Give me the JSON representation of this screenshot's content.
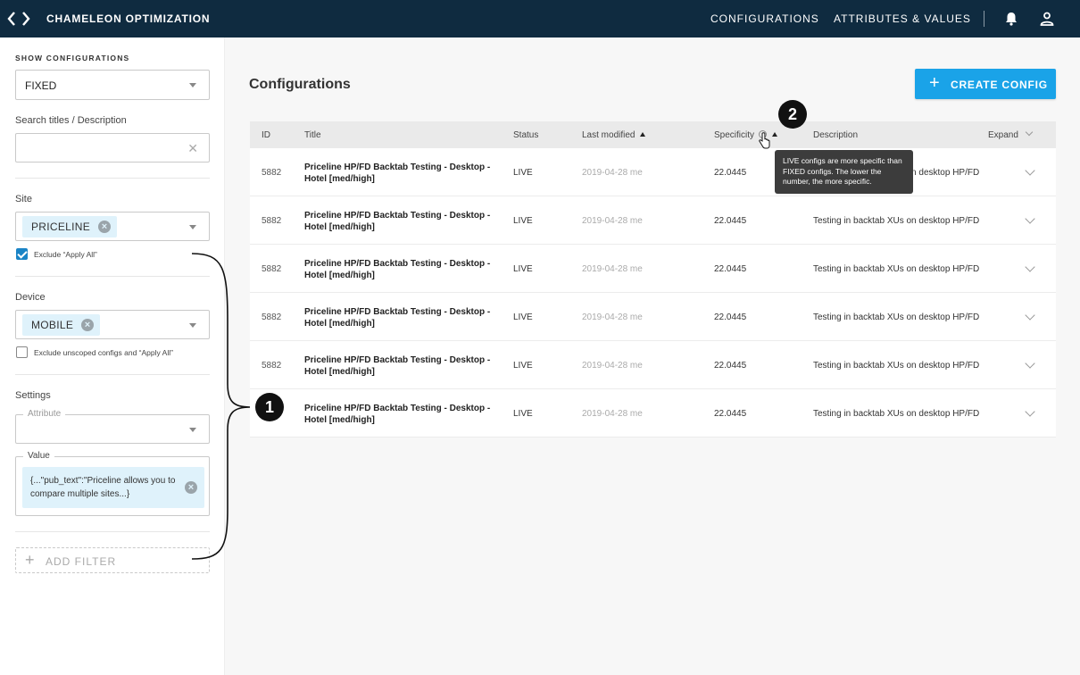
{
  "header": {
    "app_title": "CHAMELEON OPTIMIZATION",
    "nav": [
      "CONFIGURATIONS",
      "ATTRIBUTES & VALUES"
    ],
    "icons": [
      "code-logo-icon",
      "bell-icon",
      "user-icon"
    ]
  },
  "sidebar": {
    "show_label": "SHOW CONFIGURATIONS",
    "show_value": "FIXED",
    "search_label": "Search titles / Description",
    "search_value": "",
    "site_label": "Site",
    "site_chip": "PRICELINE",
    "site_exclude_label": "Exclude “Apply All”",
    "site_exclude_checked": true,
    "device_label": "Device",
    "device_chip": "MOBILE",
    "device_exclude_label": "Exclude unscoped configs and “Apply All”",
    "device_exclude_checked": false,
    "settings_label": "Settings",
    "attribute_label": "Attribute",
    "value_label": "Value",
    "value_text": "{...\"pub_text\":\"Priceline allows you to compare multiple sites...}",
    "add_filter_label": "ADD FILTER"
  },
  "main": {
    "title": "Configurations",
    "create_label": "CREATE CONFIG",
    "columns": [
      "ID",
      "Title",
      "Status",
      "Last modified",
      "Specificity",
      "Description",
      "Expand"
    ],
    "tooltip": "LIVE configs are more specific than FIXED configs. The lower the number, the more specific.",
    "rows": [
      {
        "id": "5882",
        "title": "Priceline HP/FD Backtab Testing - Desktop - Hotel [med/high]",
        "status": "LIVE",
        "modified": "2019-04-28  me",
        "specificity": "22.0445",
        "description": "Testing in backtab XUs on desktop HP/FD"
      },
      {
        "id": "5882",
        "title": "Priceline HP/FD Backtab Testing - Desktop - Hotel [med/high]",
        "status": "LIVE",
        "modified": "2019-04-28  me",
        "specificity": "22.0445",
        "description": "Testing in backtab XUs on desktop HP/FD"
      },
      {
        "id": "5882",
        "title": "Priceline HP/FD Backtab Testing - Desktop - Hotel [med/high]",
        "status": "LIVE",
        "modified": "2019-04-28  me",
        "specificity": "22.0445",
        "description": "Testing in backtab XUs on desktop HP/FD"
      },
      {
        "id": "5882",
        "title": "Priceline HP/FD Backtab Testing - Desktop - Hotel [med/high]",
        "status": "LIVE",
        "modified": "2019-04-28  me",
        "specificity": "22.0445",
        "description": "Testing in backtab XUs on desktop HP/FD"
      },
      {
        "id": "5882",
        "title": "Priceline HP/FD Backtab Testing - Desktop - Hotel [med/high]",
        "status": "LIVE",
        "modified": "2019-04-28  me",
        "specificity": "22.0445",
        "description": "Testing in backtab XUs on desktop HP/FD"
      },
      {
        "id": "5882",
        "title": "Priceline HP/FD Backtab Testing - Desktop - Hotel [med/high]",
        "status": "LIVE",
        "modified": "2019-04-28  me",
        "specificity": "22.0445",
        "description": "Testing in backtab XUs on desktop HP/FD"
      }
    ]
  },
  "annotations": {
    "badge_1": "1",
    "badge_2": "2"
  },
  "colors": {
    "header_bg": "#0f2b40",
    "accent": "#1aa3e8",
    "chip_bg": "#dff2fb",
    "checkbox": "#1a84c6"
  }
}
